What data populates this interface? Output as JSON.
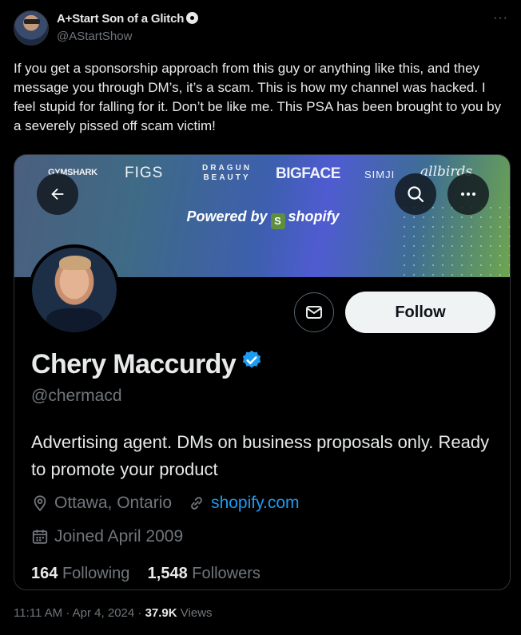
{
  "tweet": {
    "author": {
      "name": "A+Start Son of a Glitch",
      "handle": "@AStartShow"
    },
    "more": "···",
    "text": "If you get a sponsorship approach from this guy or anything like this, and they message you through DM’s, it’s a scam. This is how my channel was hacked. I feel stupid for falling for it. Don’t be like me. This PSA has been brought to you by a severely pissed off scam victim!",
    "time": "11:11 AM",
    "separator1": "·",
    "date": "Apr 4, 2024",
    "separator2": "·",
    "views_count": "37.9K",
    "views_label": "Views"
  },
  "profile_card": {
    "banner": {
      "brands": {
        "gymshark": "GYMSHARK",
        "figs": "FIGS",
        "dragun": "DRAGUN BEAUTY",
        "bigface": "BIGFACE",
        "simji": "SIMJI",
        "allbirds": "allbirds"
      },
      "powered_by": "Powered by",
      "shopify": "shopify"
    },
    "display_name": "Chery Maccurdy",
    "username": "@chermacd",
    "bio": "Advertising agent. DMs on business proposals only. Ready to promote your product",
    "location": "Ottawa, Ontario",
    "website": "shopify.com",
    "joined": "Joined April 2009",
    "following_count": "164",
    "following_label": "Following",
    "followers_count": "1,548",
    "followers_label": "Followers",
    "follow_button": "Follow",
    "colors": {
      "link": "#1d9bf0",
      "verified": "#1d9bf0",
      "muted": "#71767b",
      "text": "#e7e9ea"
    }
  }
}
